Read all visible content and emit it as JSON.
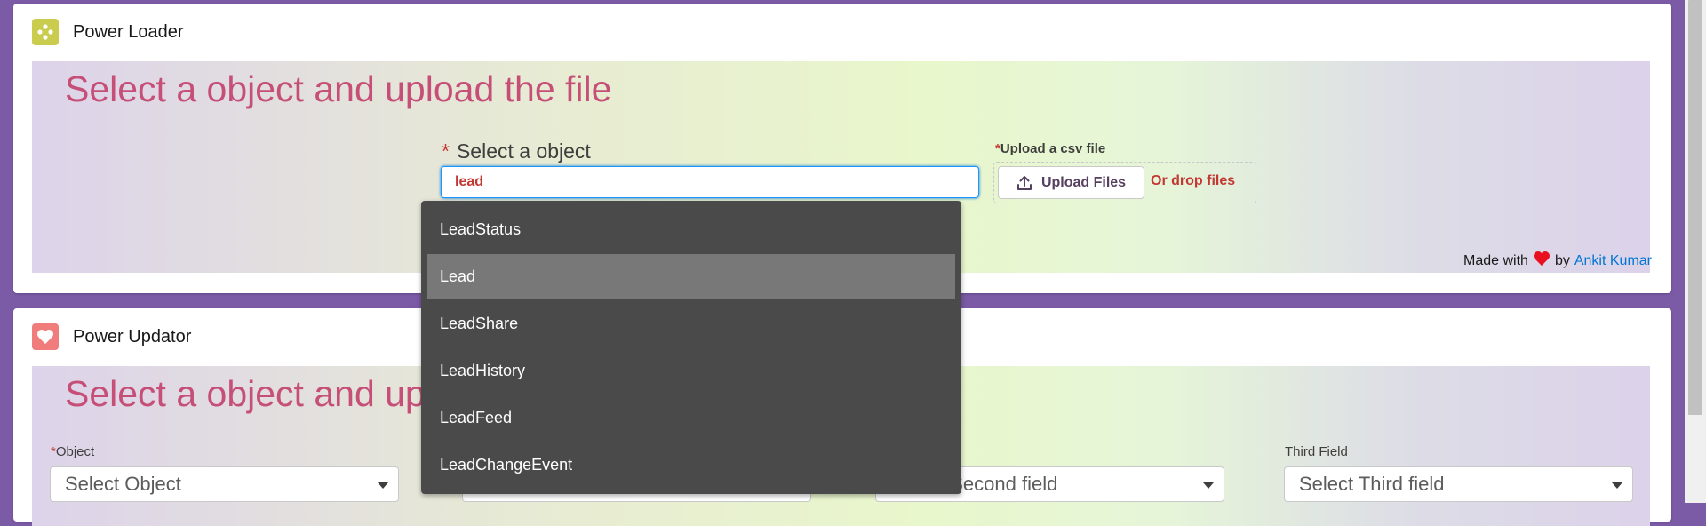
{
  "loader": {
    "title": "Power Loader",
    "heading": "Select a object and upload the file",
    "object_label": "Select a object",
    "object_value": "lead",
    "upload_label": "Upload a csv file",
    "upload_button": "Upload Files",
    "drop_text": "Or drop files",
    "made_with": "Made with",
    "by": "by",
    "author": "Ankit Kumar",
    "required_mark": "*"
  },
  "updator": {
    "title": "Power Updator",
    "heading": "Select a object and upload the file",
    "fields": [
      {
        "label": "Object",
        "placeholder": "Select Object"
      },
      {
        "label": "",
        "placeholder": "Select Second field"
      },
      {
        "label": "Third Field",
        "placeholder": "Select Third field"
      }
    ]
  },
  "dropdown": {
    "options": [
      "LeadStatus",
      "Lead",
      "LeadShare",
      "LeadHistory",
      "LeadFeed",
      "LeadChangeEvent"
    ],
    "highlighted": "Lead"
  },
  "colors": {
    "accent_red": "#c23934",
    "heading_pink": "#c64f78",
    "window_bg": "#7b5aa6",
    "dropdown_bg": "#4a4a4a",
    "dropdown_highlight": "#787878",
    "link_blue": "#0176d3"
  },
  "icons": {
    "loader_app": "cluster-icon",
    "updator_app": "heart-icon",
    "upload": "upload-icon",
    "chevron": "chevron-down-icon"
  }
}
